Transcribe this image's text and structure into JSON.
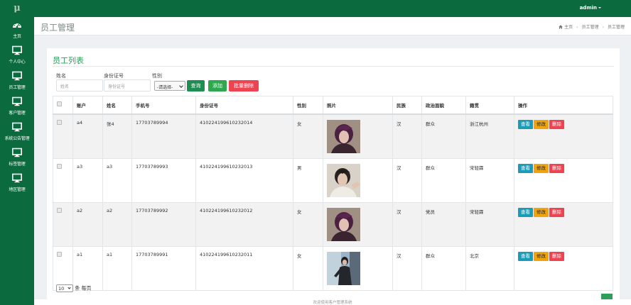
{
  "app": {
    "logo": "μ",
    "user": "admin"
  },
  "sidebar": {
    "items": [
      {
        "label": "主页",
        "icon": "dashboard-icon"
      },
      {
        "label": "个人中心",
        "icon": "monitor-icon"
      },
      {
        "label": "员工管理",
        "icon": "monitor-icon"
      },
      {
        "label": "客户管理",
        "icon": "monitor-icon"
      },
      {
        "label": "系统公告管理",
        "icon": "monitor-icon"
      },
      {
        "label": "标签管理",
        "icon": "monitor-icon"
      },
      {
        "label": "地区管理",
        "icon": "monitor-icon"
      }
    ]
  },
  "header": {
    "title": "员工管理",
    "breadcrumb": [
      "主页",
      "员工管理",
      "员工管理"
    ]
  },
  "card": {
    "title": "员工列表"
  },
  "filters": {
    "name_label": "姓名",
    "name_placeholder": "姓名",
    "idcard_label": "身份证号",
    "idcard_placeholder": "身份证号",
    "gender_label": "性别",
    "gender_value": "-请选择-",
    "query_button": "查询",
    "add_button": "添加",
    "batch_delete_button": "批量删除"
  },
  "table": {
    "columns": [
      "账户",
      "姓名",
      "手机号",
      "身份证号",
      "性别",
      "照片",
      "民族",
      "政治面貌",
      "籍贯",
      "操作"
    ],
    "actions": {
      "view": "查看",
      "edit": "修改",
      "delete": "删除"
    },
    "rows": [
      {
        "account": "a4",
        "name": "张4",
        "phone": "17703789994",
        "idcard": "410224199610232014",
        "gender": "女",
        "ethnicity": "汉",
        "political": "群众",
        "hometown": "浙江杭州"
      },
      {
        "account": "a3",
        "name": "a3",
        "phone": "17703789993",
        "idcard": "410224199610232013",
        "gender": "男",
        "ethnicity": "汉",
        "political": "群众",
        "hometown": "宋轻霖"
      },
      {
        "account": "a2",
        "name": "a2",
        "phone": "17703789992",
        "idcard": "410224199610232012",
        "gender": "女",
        "ethnicity": "汉",
        "political": "党员",
        "hometown": "宋轻霖"
      },
      {
        "account": "a1",
        "name": "a1",
        "phone": "17703789991",
        "idcard": "410224199610232011",
        "gender": "女",
        "ethnicity": "汉",
        "political": "群众",
        "hometown": "北京"
      }
    ]
  },
  "pagination": {
    "page_size": "10",
    "per_page_label": "条 每页"
  },
  "footer": {
    "text": "欢迎使用客户管理系统"
  },
  "colors": {
    "brand_green": "#0b6b3e",
    "accent_green": "#2e9e5b",
    "danger": "#ee4452",
    "info": "#1a9bb7",
    "warning": "#f0a30a"
  }
}
